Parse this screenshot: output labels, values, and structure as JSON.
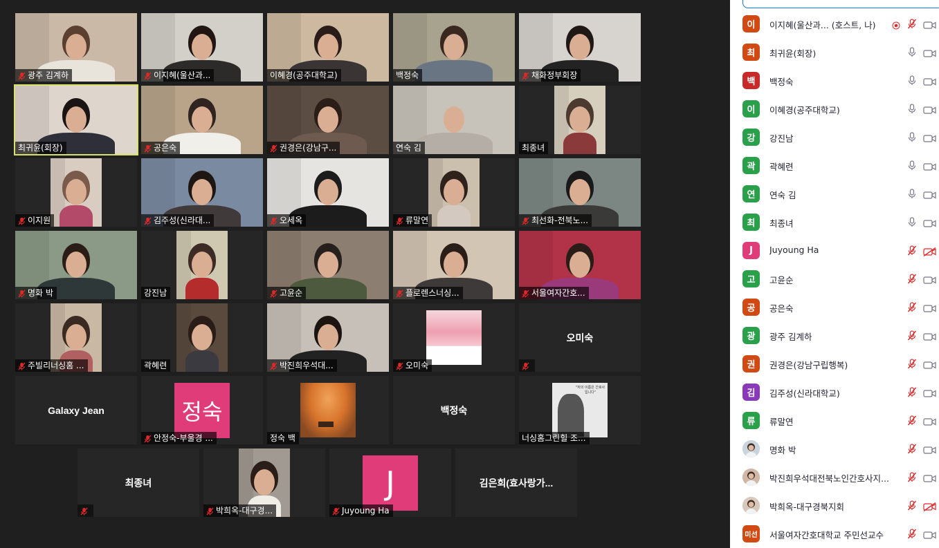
{
  "gallery": {
    "tiles": [
      {
        "name": "광주 김계하",
        "muted": true,
        "video": "full",
        "bg": "#c9b9a6",
        "body": "#e8e4dc",
        "hair": "#5a4030",
        "active": false
      },
      {
        "name": "이지혜(울산과...",
        "muted": true,
        "video": "full",
        "bg": "#d2d0c8",
        "body": "#2d2a2a",
        "hair": "#211612",
        "active": false
      },
      {
        "name": "이혜경(공주대학교)",
        "muted": false,
        "video": "full",
        "bg": "#cdb9a0",
        "body": "#3b3434",
        "hair": "#2a1c18",
        "active": false
      },
      {
        "name": "백정숙",
        "muted": false,
        "video": "full",
        "bg": "#a8a38f",
        "body": "#6a7583",
        "hair": "#3a2820",
        "active": false
      },
      {
        "name": "채화정부회장",
        "muted": true,
        "video": "full",
        "bg": "#d7d3cf",
        "body": "#232323",
        "hair": "#1f1815",
        "active": false
      },
      {
        "name": "최귀윤(회장)",
        "muted": false,
        "video": "full",
        "bg": "#ded5cd",
        "body": "#2f2f3a",
        "hair": "#1a1412",
        "active": true
      },
      {
        "name": "공은숙",
        "muted": true,
        "video": "full",
        "bg": "#b9a48a",
        "body": "#f1efe9",
        "hair": "#2f2420",
        "active": false
      },
      {
        "name": "권경은(강남구...",
        "muted": true,
        "video": "full",
        "bg": "#5c4d43",
        "body": "#6e5a4e",
        "hair": "#2b1d18",
        "active": false
      },
      {
        "name": "연숙 김",
        "muted": false,
        "video": "full",
        "bg": "#c8c3ba",
        "body": "#b4aea6",
        "hair": "#c8c3ba",
        "active": false
      },
      {
        "name": "최종녀",
        "muted": false,
        "video": "narrow",
        "bg": "#d6cfbd",
        "body": "#8a3a3a",
        "hair": "#4a3a30",
        "active": false
      },
      {
        "name": "이지원",
        "muted": true,
        "video": "narrow",
        "bg": "#d9cdc2",
        "body": "#b34a6a",
        "hair": "#7a5a4a",
        "active": false
      },
      {
        "name": "김주성(신라대...",
        "muted": true,
        "video": "full",
        "bg": "#7a8aa0",
        "body": "#403a3a",
        "hair": "#1e1612",
        "active": false
      },
      {
        "name": "오세옥",
        "muted": true,
        "video": "full",
        "bg": "#e6e4e1",
        "body": "#1c1c1c",
        "hair": "#1c1c1c",
        "active": false
      },
      {
        "name": "류말연",
        "muted": true,
        "video": "narrow",
        "bg": "#cbbfae",
        "body": "#d4c9c0",
        "hair": "#2f221c",
        "active": false
      },
      {
        "name": "최선화-전북노...",
        "muted": true,
        "video": "full",
        "bg": "#7c8784",
        "body": "#3a3a38",
        "hair": "#1a1a1a",
        "active": false
      },
      {
        "name": "명화 박",
        "muted": true,
        "video": "full",
        "bg": "#8a9a86",
        "body": "#2f3838",
        "hair": "#2a1d17",
        "active": false
      },
      {
        "name": "강진남",
        "muted": false,
        "video": "narrow",
        "bg": "#d0c9b2",
        "body": "#b52c2c",
        "hair": "#3d2c26",
        "active": false
      },
      {
        "name": "고윤순",
        "muted": true,
        "video": "full",
        "bg": "#8c7e70",
        "body": "#4e5a3e",
        "hair": "#26201c",
        "active": false
      },
      {
        "name": "플로렌스너싱...",
        "muted": true,
        "video": "full",
        "bg": "#d3c5b3",
        "body": "#3e3a39",
        "hair": "#2a1e19",
        "active": false
      },
      {
        "name": "서울여자간호...",
        "muted": true,
        "video": "full",
        "bg": "#b23348",
        "body": "#9a3a7a",
        "hair": "#2a1d17",
        "active": false
      },
      {
        "name": "주빌리너싱홈 ...",
        "muted": true,
        "video": "narrow",
        "bg": "#c9b8a3",
        "body": "#b06060",
        "hair": "#3a2a22",
        "active": false
      },
      {
        "name": "곽혜련",
        "muted": false,
        "video": "narrow",
        "bg": "#5a4a3e",
        "body": "#3a3a40",
        "hair": "#2a1d17",
        "active": false
      },
      {
        "name": "박진희우석대...",
        "muted": true,
        "video": "full",
        "bg": "#c7c0b8",
        "body": "#222222",
        "hair": "#1c1410",
        "active": false
      },
      {
        "name": "오미숙",
        "muted": true,
        "video": "blossom",
        "bg": "#f2c9d2",
        "body": "#f2c9d2",
        "hair": "#f2c9d2",
        "active": false
      },
      {
        "name": "",
        "muted": true,
        "video": "none",
        "center": "오미숙",
        "active": false
      },
      {
        "name": "",
        "muted": false,
        "video": "none",
        "center": "Galaxy Jean",
        "active": false
      },
      {
        "name": "안정숙-부울경 ...",
        "muted": true,
        "video": "avatar",
        "avatar_text": "정숙",
        "active": false
      },
      {
        "name": "정숙 백",
        "muted": false,
        "video": "autumn",
        "active": false
      },
      {
        "name": "",
        "muted": false,
        "video": "none",
        "center": "백정숙",
        "active": false
      },
      {
        "name": "너싱홈그린힐 조...",
        "muted": false,
        "video": "poster",
        "poster_text": "\"저의 이름은 간호사입니다\"",
        "active": false
      },
      {
        "name": "",
        "muted": true,
        "video": "none",
        "center": "최종녀",
        "active": false
      },
      {
        "name": "박희옥-대구경...",
        "muted": true,
        "video": "narrow",
        "bg": "#a09a92",
        "body": "#f0ece6",
        "hair": "#2b1d17",
        "active": false
      },
      {
        "name": "Juyoung Ha",
        "muted": true,
        "video": "avatar",
        "avatar_text": "J",
        "active": false
      },
      {
        "name": "",
        "muted": false,
        "video": "none",
        "center": "김은희(효사랑가...",
        "active": false
      }
    ]
  },
  "panel": {
    "participants": [
      {
        "initial": "이",
        "color": "#d24a13",
        "name": "이지혜(울산과...",
        "tag": "(호스트, 나)",
        "rec": true,
        "mic_muted": true,
        "cam_off": false
      },
      {
        "initial": "최",
        "color": "#d24a13",
        "name": "최귀윤(회장)",
        "tag": "",
        "rec": false,
        "mic_muted": false,
        "cam_off": false
      },
      {
        "initial": "백",
        "color": "#c82a2a",
        "name": "백정숙",
        "tag": "",
        "rec": false,
        "mic_muted": false,
        "cam_off": false
      },
      {
        "initial": "이",
        "color": "#2aa04a",
        "name": "이혜경(공주대학교)",
        "tag": "",
        "rec": false,
        "mic_muted": false,
        "cam_off": false
      },
      {
        "initial": "강",
        "color": "#2aa04a",
        "name": "강진남",
        "tag": "",
        "rec": false,
        "mic_muted": false,
        "cam_off": false
      },
      {
        "initial": "곽",
        "color": "#2aa04a",
        "name": "곽혜련",
        "tag": "",
        "rec": false,
        "mic_muted": false,
        "cam_off": false
      },
      {
        "initial": "연",
        "color": "#2aa04a",
        "name": "연숙 김",
        "tag": "",
        "rec": false,
        "mic_muted": false,
        "cam_off": false
      },
      {
        "initial": "최",
        "color": "#2aa04a",
        "name": "최종녀",
        "tag": "",
        "rec": false,
        "mic_muted": false,
        "cam_off": false
      },
      {
        "initial": "J",
        "color": "#e03c7a",
        "name": "Juyoung Ha",
        "tag": "",
        "rec": false,
        "mic_muted": true,
        "cam_off": true
      },
      {
        "initial": "고",
        "color": "#2aa04a",
        "name": "고윤순",
        "tag": "",
        "rec": false,
        "mic_muted": true,
        "cam_off": false
      },
      {
        "initial": "공",
        "color": "#d24a13",
        "name": "공은숙",
        "tag": "",
        "rec": false,
        "mic_muted": true,
        "cam_off": false
      },
      {
        "initial": "광",
        "color": "#2aa04a",
        "name": "광주 김계하",
        "tag": "",
        "rec": false,
        "mic_muted": true,
        "cam_off": false
      },
      {
        "initial": "권",
        "color": "#d24a13",
        "name": "권경은(강남구립행복)",
        "tag": "",
        "rec": false,
        "mic_muted": true,
        "cam_off": false
      },
      {
        "initial": "김",
        "color": "#8a3ab8",
        "name": "김주성(신라대학교)",
        "tag": "",
        "rec": false,
        "mic_muted": true,
        "cam_off": false
      },
      {
        "initial": "류",
        "color": "#2aa04a",
        "name": "류말연",
        "tag": "",
        "rec": false,
        "mic_muted": true,
        "cam_off": false
      },
      {
        "initial": "",
        "color": "#c9d4dc",
        "name": "명화 박",
        "tag": "",
        "rec": false,
        "mic_muted": true,
        "cam_off": false,
        "photo": true
      },
      {
        "initial": "",
        "color": "#d0b8a8",
        "name": "박진희우석대전북노인간호사지...",
        "tag": "",
        "rec": false,
        "mic_muted": true,
        "cam_off": false,
        "photo": true
      },
      {
        "initial": "",
        "color": "#d8c8bc",
        "name": "박희옥-대구경북지회",
        "tag": "",
        "rec": false,
        "mic_muted": true,
        "cam_off": true,
        "photo": true
      },
      {
        "initial": "미선",
        "color": "#d24a13",
        "name": "서울여자간호대학교 주민선교수",
        "tag": "",
        "rec": false,
        "mic_muted": true,
        "cam_off": false
      }
    ]
  }
}
